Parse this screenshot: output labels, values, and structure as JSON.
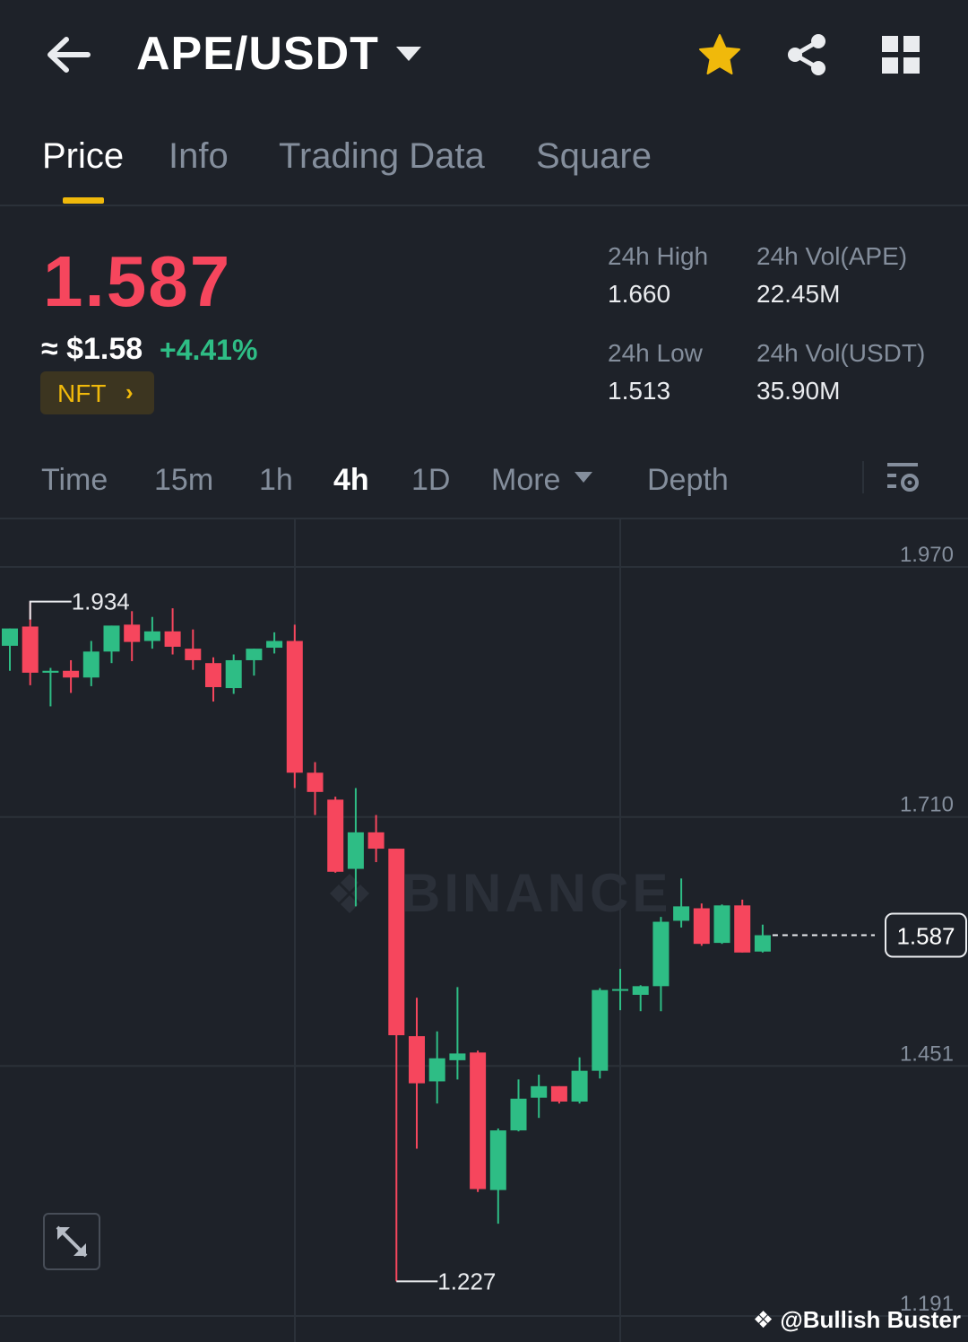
{
  "header": {
    "pair": "APE/USDT",
    "icons": [
      "back-arrow-icon",
      "caret-down-icon",
      "star-icon",
      "share-icon",
      "grid-menu-icon"
    ],
    "star_color": "#f0b90b"
  },
  "tabs": [
    {
      "label": "Price",
      "active": true
    },
    {
      "label": "Info",
      "active": false
    },
    {
      "label": "Trading Data",
      "active": false
    },
    {
      "label": "Square",
      "active": false
    }
  ],
  "ticker": {
    "last_price": "1.587",
    "usd_price": "≈ $1.58",
    "change_pct": "+4.41%",
    "nft_label": "NFT",
    "high_label": "24h High",
    "high_value": "1.660",
    "low_label": "24h Low",
    "low_value": "1.513",
    "vol_base_label": "24h Vol(APE)",
    "vol_base_value": "22.45M",
    "vol_quote_label": "24h Vol(USDT)",
    "vol_quote_value": "35.90M"
  },
  "intervals": [
    {
      "label": "Time",
      "active": false
    },
    {
      "label": "15m",
      "active": false
    },
    {
      "label": "1h",
      "active": false
    },
    {
      "label": "4h",
      "active": true
    },
    {
      "label": "1D",
      "active": false
    },
    {
      "label": "More",
      "active": false
    },
    {
      "label": "Depth",
      "active": false
    }
  ],
  "colors": {
    "up": "#2ebd85",
    "down": "#f6465d",
    "accent": "#f0b90b",
    "background": "#1e2229"
  },
  "watermark": {
    "brand": "BINANCE",
    "handle": "@Bullish Buster"
  },
  "chart_data": {
    "type": "candlestick",
    "interval": "4h",
    "y_ticks": [
      "1.970",
      "1.710",
      "1.451",
      "1.191"
    ],
    "ylim": [
      1.191,
      1.97
    ],
    "current_price_label": "1.587",
    "max_label": "1.934",
    "min_label": "1.227",
    "candles": [
      {
        "o": 1.888,
        "h": 1.894,
        "l": 1.862,
        "c": 1.906
      },
      {
        "o": 1.908,
        "h": 1.934,
        "l": 1.847,
        "c": 1.86
      },
      {
        "o": 1.86,
        "h": 1.865,
        "l": 1.825,
        "c": 1.862
      },
      {
        "o": 1.862,
        "h": 1.873,
        "l": 1.839,
        "c": 1.855
      },
      {
        "o": 1.855,
        "h": 1.893,
        "l": 1.846,
        "c": 1.882
      },
      {
        "o": 1.882,
        "h": 1.909,
        "l": 1.87,
        "c": 1.909
      },
      {
        "o": 1.91,
        "h": 1.924,
        "l": 1.872,
        "c": 1.892
      },
      {
        "o": 1.893,
        "h": 1.918,
        "l": 1.885,
        "c": 1.903
      },
      {
        "o": 1.903,
        "h": 1.927,
        "l": 1.879,
        "c": 1.887
      },
      {
        "o": 1.885,
        "h": 1.905,
        "l": 1.863,
        "c": 1.873
      },
      {
        "o": 1.87,
        "h": 1.876,
        "l": 1.83,
        "c": 1.845
      },
      {
        "o": 1.844,
        "h": 1.879,
        "l": 1.838,
        "c": 1.873
      },
      {
        "o": 1.873,
        "h": 1.885,
        "l": 1.857,
        "c": 1.885
      },
      {
        "o": 1.886,
        "h": 1.902,
        "l": 1.88,
        "c": 1.893
      },
      {
        "o": 1.893,
        "h": 1.91,
        "l": 1.74,
        "c": 1.756
      },
      {
        "o": 1.756,
        "h": 1.767,
        "l": 1.712,
        "c": 1.736
      },
      {
        "o": 1.728,
        "h": 1.731,
        "l": 1.652,
        "c": 1.653
      },
      {
        "o": 1.656,
        "h": 1.74,
        "l": 1.617,
        "c": 1.694
      },
      {
        "o": 1.694,
        "h": 1.712,
        "l": 1.663,
        "c": 1.677
      },
      {
        "o": 1.677,
        "h": 1.677,
        "l": 1.227,
        "c": 1.483
      },
      {
        "o": 1.482,
        "h": 1.522,
        "l": 1.365,
        "c": 1.433
      },
      {
        "o": 1.435,
        "h": 1.487,
        "l": 1.412,
        "c": 1.459
      },
      {
        "o": 1.457,
        "h": 1.533,
        "l": 1.437,
        "c": 1.464
      },
      {
        "o": 1.465,
        "h": 1.467,
        "l": 1.32,
        "c": 1.323
      },
      {
        "o": 1.322,
        "h": 1.386,
        "l": 1.287,
        "c": 1.384
      },
      {
        "o": 1.384,
        "h": 1.437,
        "l": 1.383,
        "c": 1.417
      },
      {
        "o": 1.418,
        "h": 1.442,
        "l": 1.397,
        "c": 1.43
      },
      {
        "o": 1.43,
        "h": 1.43,
        "l": 1.412,
        "c": 1.414
      },
      {
        "o": 1.414,
        "h": 1.46,
        "l": 1.412,
        "c": 1.446
      },
      {
        "o": 1.446,
        "h": 1.532,
        "l": 1.438,
        "c": 1.53
      },
      {
        "o": 1.53,
        "h": 1.552,
        "l": 1.509,
        "c": 1.531
      },
      {
        "o": 1.525,
        "h": 1.535,
        "l": 1.508,
        "c": 1.534
      },
      {
        "o": 1.534,
        "h": 1.606,
        "l": 1.508,
        "c": 1.601
      },
      {
        "o": 1.602,
        "h": 1.646,
        "l": 1.595,
        "c": 1.617
      },
      {
        "o": 1.615,
        "h": 1.62,
        "l": 1.576,
        "c": 1.578
      },
      {
        "o": 1.579,
        "h": 1.619,
        "l": 1.578,
        "c": 1.618
      },
      {
        "o": 1.618,
        "h": 1.624,
        "l": 1.57,
        "c": 1.569
      },
      {
        "o": 1.57,
        "h": 1.598,
        "l": 1.569,
        "c": 1.587
      }
    ]
  }
}
